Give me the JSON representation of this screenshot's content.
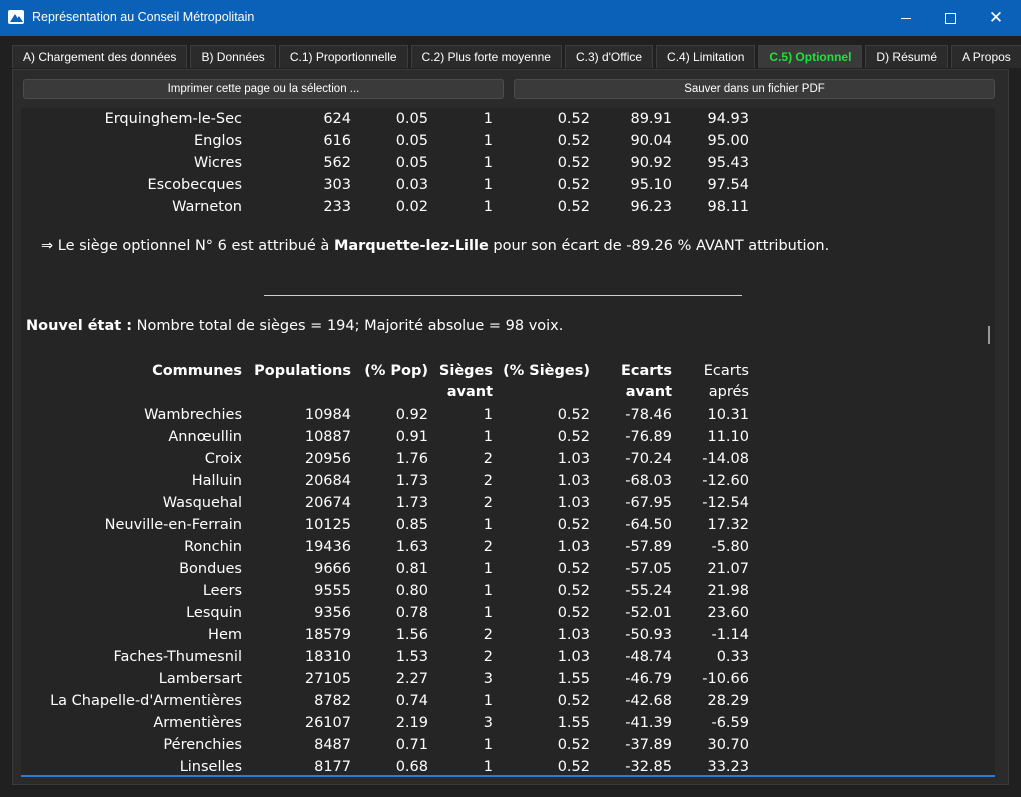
{
  "window": {
    "title": "Représentation au Conseil Métropolitain"
  },
  "tabs": [
    {
      "label": "A) Chargement des données"
    },
    {
      "label": "B) Données"
    },
    {
      "label": "C.1) Proportionnelle"
    },
    {
      "label": "C.2) Plus forte moyenne"
    },
    {
      "label": "C.3) d'Office"
    },
    {
      "label": "C.4) Limitation"
    },
    {
      "label": "C.5) Optionnel"
    },
    {
      "label": "D) Résumé"
    },
    {
      "label": "A Propos"
    }
  ],
  "active_tab_color": "#22e03a",
  "toolbar": {
    "print_label": "Imprimer cette page ou la sélection ...",
    "pdf_label": "Sauver dans un fichier PDF"
  },
  "top_rows": [
    {
      "commune": "Erquinghem-le-Sec",
      "pop": "624",
      "ppop": "0.05",
      "sieges": "1",
      "psieges": "0.52",
      "eav": "89.91",
      "eap": "94.93"
    },
    {
      "commune": "Englos",
      "pop": "616",
      "ppop": "0.05",
      "sieges": "1",
      "psieges": "0.52",
      "eav": "90.04",
      "eap": "95.00"
    },
    {
      "commune": "Wicres",
      "pop": "562",
      "ppop": "0.05",
      "sieges": "1",
      "psieges": "0.52",
      "eav": "90.92",
      "eap": "95.43"
    },
    {
      "commune": "Escobecques",
      "pop": "303",
      "ppop": "0.03",
      "sieges": "1",
      "psieges": "0.52",
      "eav": "95.10",
      "eap": "97.54"
    },
    {
      "commune": "Warneton",
      "pop": "233",
      "ppop": "0.02",
      "sieges": "1",
      "psieges": "0.52",
      "eav": "96.23",
      "eap": "98.11"
    }
  ],
  "message": {
    "arrow": "⇒",
    "prefix": "Le siège optionnel N° 6 est attribué à",
    "commune": "Marquette-lez-Lille",
    "suffix": "pour son écart de -89.26 % AVANT attribution."
  },
  "state": {
    "label": "Nouvel état :",
    "text": "Nombre total de sièges = 194; Majorité absolue = 98 voix."
  },
  "table": {
    "headers": {
      "commune": "Communes",
      "pop": "Populations",
      "ppop": "(% Pop)",
      "sieges_1": "Sièges",
      "sieges_2": "avant",
      "psieges": "(% Sièges)",
      "eav_1": "Ecarts",
      "eav_2": "avant",
      "eap_1": "Ecarts",
      "eap_2": "aprés"
    },
    "rows": [
      {
        "commune": "Wambrechies",
        "pop": "10984",
        "ppop": "0.92",
        "sieges": "1",
        "psieges": "0.52",
        "eav": "-78.46",
        "eap": "10.31"
      },
      {
        "commune": "Annœullin",
        "pop": "10887",
        "ppop": "0.91",
        "sieges": "1",
        "psieges": "0.52",
        "eav": "-76.89",
        "eap": "11.10"
      },
      {
        "commune": "Croix",
        "pop": "20956",
        "ppop": "1.76",
        "sieges": "2",
        "psieges": "1.03",
        "eav": "-70.24",
        "eap": "-14.08"
      },
      {
        "commune": "Halluin",
        "pop": "20684",
        "ppop": "1.73",
        "sieges": "2",
        "psieges": "1.03",
        "eav": "-68.03",
        "eap": "-12.60"
      },
      {
        "commune": "Wasquehal",
        "pop": "20674",
        "ppop": "1.73",
        "sieges": "2",
        "psieges": "1.03",
        "eav": "-67.95",
        "eap": "-12.54"
      },
      {
        "commune": "Neuville-en-Ferrain",
        "pop": "10125",
        "ppop": "0.85",
        "sieges": "1",
        "psieges": "0.52",
        "eav": "-64.50",
        "eap": "17.32"
      },
      {
        "commune": "Ronchin",
        "pop": "19436",
        "ppop": "1.63",
        "sieges": "2",
        "psieges": "1.03",
        "eav": "-57.89",
        "eap": "-5.80"
      },
      {
        "commune": "Bondues",
        "pop": "9666",
        "ppop": "0.81",
        "sieges": "1",
        "psieges": "0.52",
        "eav": "-57.05",
        "eap": "21.07"
      },
      {
        "commune": "Leers",
        "pop": "9555",
        "ppop": "0.80",
        "sieges": "1",
        "psieges": "0.52",
        "eav": "-55.24",
        "eap": "21.98"
      },
      {
        "commune": "Lesquin",
        "pop": "9356",
        "ppop": "0.78",
        "sieges": "1",
        "psieges": "0.52",
        "eav": "-52.01",
        "eap": "23.60"
      },
      {
        "commune": "Hem",
        "pop": "18579",
        "ppop": "1.56",
        "sieges": "2",
        "psieges": "1.03",
        "eav": "-50.93",
        "eap": "-1.14"
      },
      {
        "commune": "Faches-Thumesnil",
        "pop": "18310",
        "ppop": "1.53",
        "sieges": "2",
        "psieges": "1.03",
        "eav": "-48.74",
        "eap": "0.33"
      },
      {
        "commune": "Lambersart",
        "pop": "27105",
        "ppop": "2.27",
        "sieges": "3",
        "psieges": "1.55",
        "eav": "-46.79",
        "eap": "-10.66"
      },
      {
        "commune": "La Chapelle-d'Armentières",
        "pop": "8782",
        "ppop": "0.74",
        "sieges": "1",
        "psieges": "0.52",
        "eav": "-42.68",
        "eap": "28.29"
      },
      {
        "commune": "Armentières",
        "pop": "26107",
        "ppop": "2.19",
        "sieges": "3",
        "psieges": "1.55",
        "eav": "-41.39",
        "eap": "-6.59"
      },
      {
        "commune": "Pérenchies",
        "pop": "8487",
        "ppop": "0.71",
        "sieges": "1",
        "psieges": "0.52",
        "eav": "-37.89",
        "eap": "30.70"
      },
      {
        "commune": "Linselles",
        "pop": "8177",
        "ppop": "0.68",
        "sieges": "1",
        "psieges": "0.52",
        "eav": "-32.85",
        "eap": "33.23"
      }
    ]
  }
}
